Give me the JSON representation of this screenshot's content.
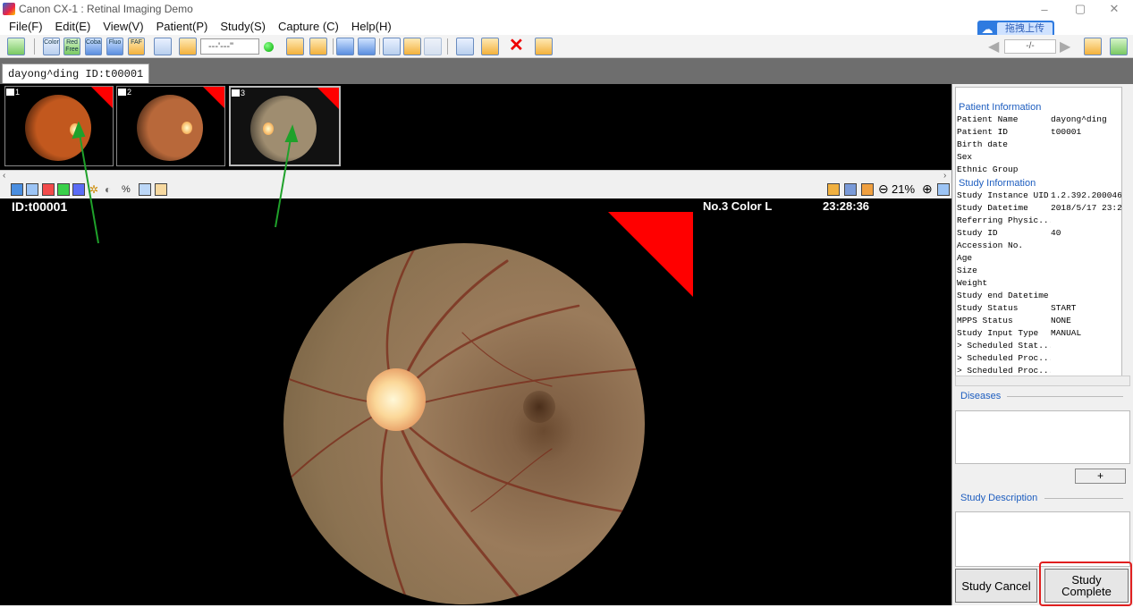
{
  "window": {
    "title": "Canon CX-1 : Retinal Imaging Demo",
    "minimize": "–",
    "maximize": "▢",
    "close": "✕"
  },
  "menu": [
    "File(F)",
    "Edit(E)",
    "View(V)",
    "Patient(P)",
    "Study(S)",
    "Capture (C)",
    "Help(H)"
  ],
  "toolbar": {
    "mode_buttons": [
      "Color",
      "Red Free",
      "Cobalt",
      "Fluo",
      "FAF"
    ],
    "dash_field": "---'---\"",
    "cloud_upload": "拖拽上传",
    "pager_value": "-/-",
    "pager_prev": "◀",
    "pager_next": "▶"
  },
  "tab": {
    "label": "dayong^ding ID:t00001"
  },
  "thumbnails": [
    {
      "number": "1",
      "tone": "#c2581e"
    },
    {
      "number": "2",
      "tone": "#b8683a"
    },
    {
      "number": "3",
      "tone": "#9f8d70"
    }
  ],
  "viewer": {
    "zoom": "21%",
    "overlay_id": "ID:t00001",
    "overlay_image": "No.3 Color  L",
    "overlay_time": "23:28:36"
  },
  "patient_info": {
    "section": "Patient Information",
    "rows": [
      {
        "k": "Patient Name",
        "v": "dayong^ding"
      },
      {
        "k": "Patient ID",
        "v": "t00001"
      },
      {
        "k": "Birth date",
        "v": ""
      },
      {
        "k": "Sex",
        "v": ""
      },
      {
        "k": "Ethnic Group",
        "v": ""
      }
    ]
  },
  "study_info": {
    "section": "Study Information",
    "rows": [
      {
        "k": "Study Instance UID",
        "v": "1.2.392.200046"
      },
      {
        "k": "Study Datetime",
        "v": "2018/5/17 23:2"
      },
      {
        "k": "Referring Physic...",
        "v": ""
      },
      {
        "k": "Study ID",
        "v": "40"
      },
      {
        "k": "Accession No.",
        "v": ""
      },
      {
        "k": "Age",
        "v": ""
      },
      {
        "k": "Size",
        "v": ""
      },
      {
        "k": "Weight",
        "v": ""
      },
      {
        "k": "Study end Datetime",
        "v": ""
      },
      {
        "k": "Study Status",
        "v": "START"
      },
      {
        "k": "MPPS Status",
        "v": "NONE"
      },
      {
        "k": "Study Input Type",
        "v": "MANUAL"
      },
      {
        "k": "> Scheduled Stat...",
        "v": ""
      },
      {
        "k": "> Scheduled Proc...",
        "v": ""
      },
      {
        "k": "> Scheduled Proc...",
        "v": ""
      }
    ]
  },
  "diseases": {
    "label": "Diseases",
    "add": "+"
  },
  "study_description": {
    "label": "Study Description"
  },
  "buttons": {
    "cancel": "Study Cancel",
    "complete_line1": "Study",
    "complete_line2": "Complete"
  },
  "colors": {
    "highlight": "#e02020",
    "arrow": "#1fa12a",
    "marker": "#ff0000",
    "section_text": "#1d5dbf"
  }
}
